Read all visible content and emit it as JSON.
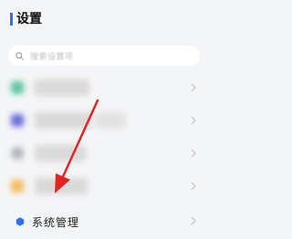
{
  "header": {
    "title": "设置"
  },
  "search": {
    "placeholder": "搜索设置项"
  },
  "list": {
    "items": [
      {
        "label": "",
        "icon": "app-icon-green",
        "color": "#5cc8a0"
      },
      {
        "label": "",
        "icon": "app-icon-blue",
        "color": "#6b6fd8"
      },
      {
        "label": "",
        "icon": "app-icon-gray",
        "color": "#b0b4bc"
      },
      {
        "label": "",
        "icon": "app-icon-orange",
        "color": "#f3bb5a"
      },
      {
        "label": "系统管理",
        "icon": "system-hexagon-icon",
        "color": "#2f6ff0"
      }
    ]
  },
  "colors": {
    "accent": "#2f6ff0",
    "annotation_arrow": "#e32424"
  }
}
